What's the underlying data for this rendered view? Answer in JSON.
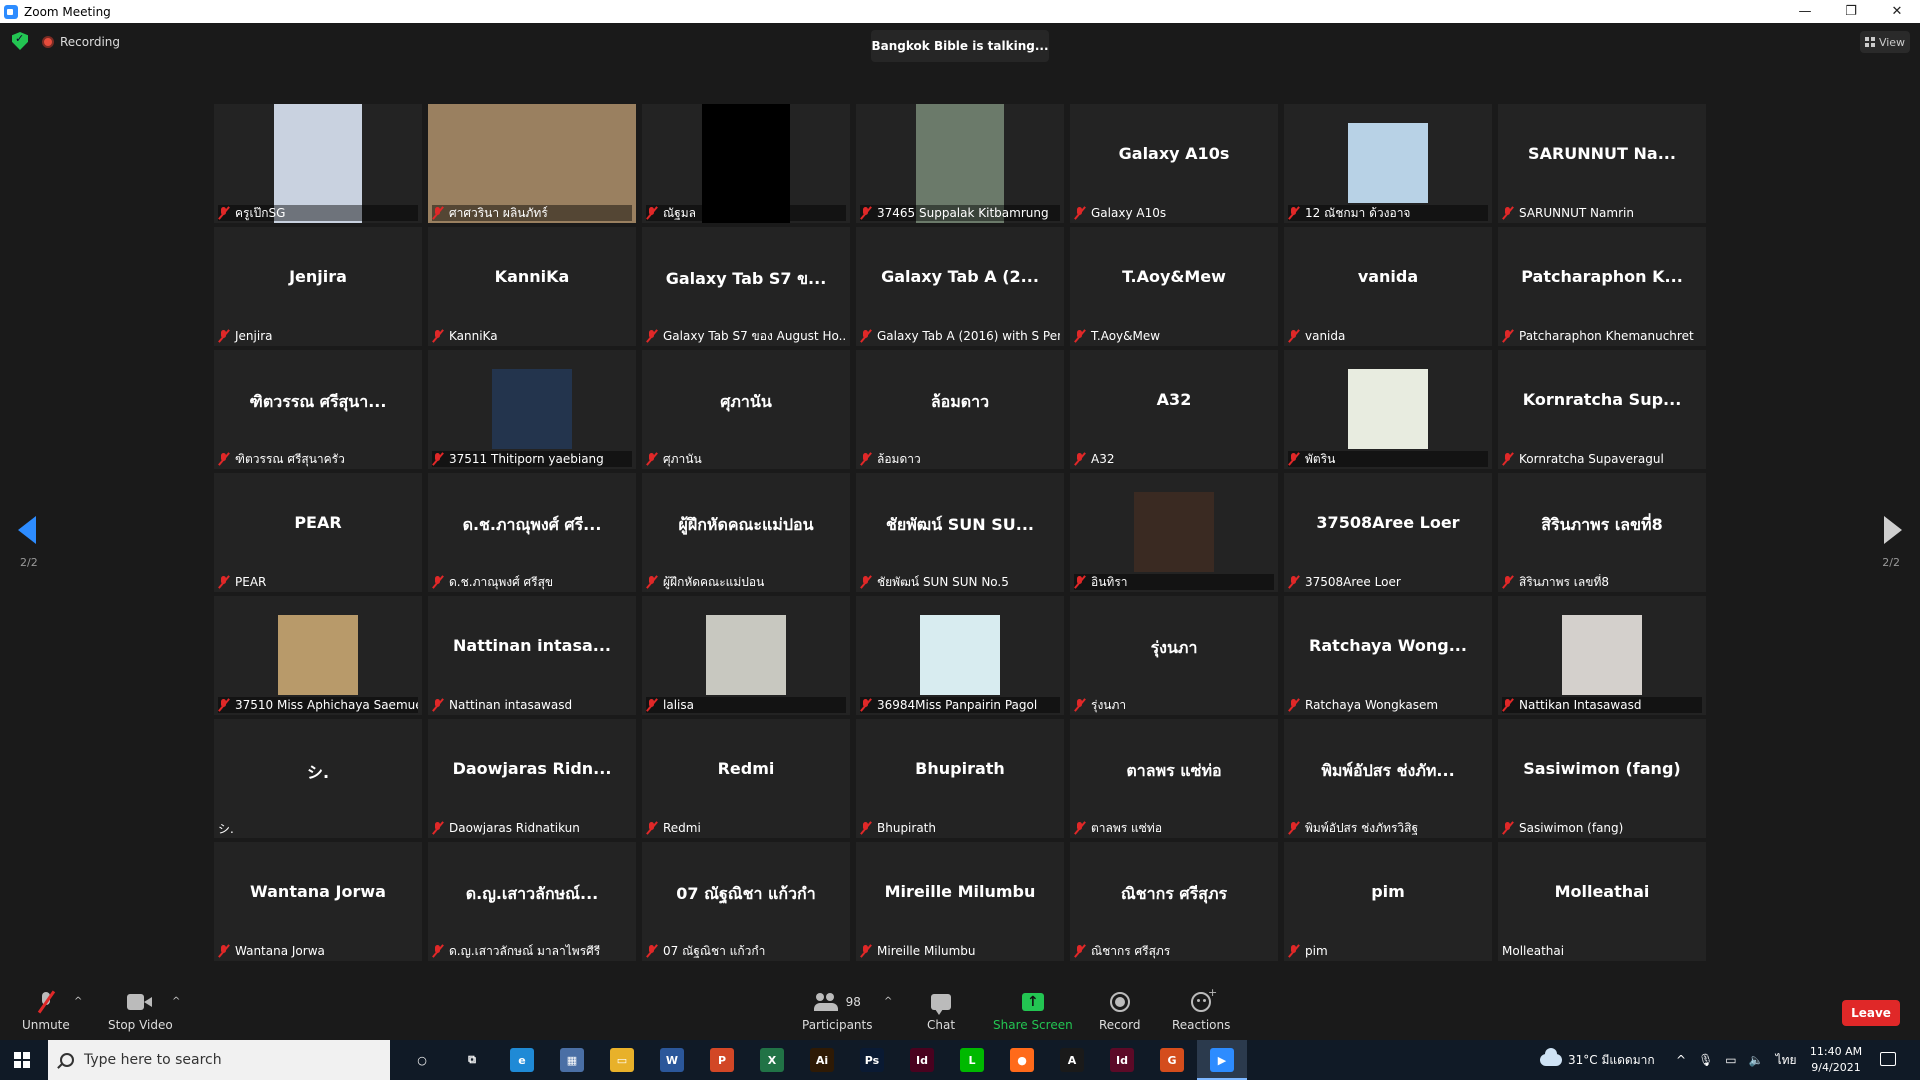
{
  "window": {
    "title": "Zoom Meeting",
    "minimize": "—",
    "restore": "❐",
    "close": "✕"
  },
  "topbar": {
    "recording": "Recording",
    "talking": "Bangkok Bible is talking...",
    "view": "View"
  },
  "page_indicator": {
    "left": "2/2",
    "right": "2/2"
  },
  "participants": [
    {
      "label": "ครูเป๊กSG",
      "photo": true,
      "photo_color": "#c9d2e0",
      "photo_type": "portrait"
    },
    {
      "label": "ศาศวรินา ผลินภัทร์",
      "photo": true,
      "photo_color": "#9a8060",
      "photo_type": "wide"
    },
    {
      "label": "ณัฐมล",
      "photo": true,
      "photo_color": "#000000",
      "photo_type": "portrait"
    },
    {
      "label": "37465 Suppalak Kitbamrung",
      "photo": true,
      "photo_color": "#6b7a6a",
      "photo_type": "portrait"
    },
    {
      "name": "Galaxy A10s",
      "label": "Galaxy A10s"
    },
    {
      "label": "12 ณัชกมา ด้วงอาจ",
      "photo": true,
      "photo_color": "#b8d2e6",
      "photo_type": "square"
    },
    {
      "name": "SARUNNUT Na...",
      "label": "SARUNNUT Namrin"
    },
    {
      "name": "Jenjira",
      "label": "Jenjira"
    },
    {
      "name": "KanniKa",
      "label": "KanniKa"
    },
    {
      "name": "Galaxy Tab S7 ข...",
      "label": "Galaxy Tab S7 ของ August Ho..."
    },
    {
      "name": "Galaxy Tab A (2...",
      "label": "Galaxy Tab A (2016) with S Pen"
    },
    {
      "name": "T.Aoy&Mew",
      "label": "T.Aoy&Mew"
    },
    {
      "name": "vanida",
      "label": "vanida"
    },
    {
      "name": "Patcharaphon K...",
      "label": "Patcharaphon Khemanuchret"
    },
    {
      "name": "ฑิตวรรณ ศรีสุนา...",
      "label": "ฑิตวรรณ ศรีสุนาครัว"
    },
    {
      "label": "37511 Thitiporn yaebiang",
      "photo": true,
      "photo_color": "#23344d",
      "photo_type": "square"
    },
    {
      "name": "ศุภานัน",
      "label": "ศุภานัน"
    },
    {
      "name": "ล้อมดาว",
      "label": "ล้อมดาว"
    },
    {
      "name": "A32",
      "label": "A32"
    },
    {
      "label": "พัตริน",
      "photo": true,
      "photo_color": "#e8ece0",
      "photo_type": "square"
    },
    {
      "name": "Kornratcha Sup...",
      "label": "Kornratcha Supaveragul"
    },
    {
      "name": "PEAR",
      "label": "PEAR"
    },
    {
      "name": "ด.ช.ภาณุพงศ์ ศรี...",
      "label": "ด.ช.ภาณุพงศ์ ศรีสุข"
    },
    {
      "name": "ผู้ฝึกหัดคณะแม่ปอน",
      "label": "ผู้ฝึกหัดคณะแม่ปอน"
    },
    {
      "name": "ชัยพัฒน์ SUN SU...",
      "label": "ชัยพัฒน์ SUN SUN No.5"
    },
    {
      "label": "อินทิรา",
      "photo": true,
      "photo_color": "#3a2a22",
      "photo_type": "square"
    },
    {
      "name": "37508Aree Loer",
      "label": "37508Aree Loer"
    },
    {
      "name": "สิรินภาพร เลขที่8",
      "label": "สิรินภาพร เลขที่8"
    },
    {
      "label": "37510 Miss Aphichaya Saemue",
      "photo": true,
      "photo_color": "#b89a6a",
      "photo_type": "square"
    },
    {
      "name": "Nattinan intasa...",
      "label": "Nattinan intasawasd"
    },
    {
      "label": "lalisa",
      "photo": true,
      "photo_color": "#c8c8c0",
      "photo_type": "square"
    },
    {
      "label": "36984Miss Panpairin Pagol",
      "photo": true,
      "photo_color": "#d8ecf0",
      "photo_type": "square"
    },
    {
      "name": "รุ่งนภา",
      "label": "รุ่งนภา"
    },
    {
      "name": "Ratchaya Wong...",
      "label": "Ratchaya Wongkasem"
    },
    {
      "label": "Nattikan Intasawasd",
      "photo": true,
      "photo_color": "#d4d0cc",
      "photo_type": "square"
    },
    {
      "name": "シ.",
      "label": "シ.",
      "unmuted": true
    },
    {
      "name": "Daowjaras Ridn...",
      "label": "Daowjaras Ridnatikun"
    },
    {
      "name": "Redmi",
      "label": "Redmi"
    },
    {
      "name": "Bhupirath",
      "label": "Bhupirath"
    },
    {
      "name": "ตาลพร แซ่ท่อ",
      "label": "ตาลพร แซ่ท่อ"
    },
    {
      "name": "พิมพ์อัปสร ช่งภัท...",
      "label": "พิมพ์อัปสร ช่งภัทรวิสิฐ"
    },
    {
      "name": "Sasiwimon (fang)",
      "label": "Sasiwimon (fang)"
    },
    {
      "name": "Wantana Jorwa",
      "label": "Wantana Jorwa"
    },
    {
      "name": "ด.ญ.เสาวลักษณ์...",
      "label": "ด.ญ.เสาวลักษณ์ มาลาไพรศีรี"
    },
    {
      "name": "07 ณัฐณิชา แก้วกำ",
      "label": "07 ณัฐณิชา แก้วกำ"
    },
    {
      "name": "Mireille Milumbu",
      "label": "Mireille Milumbu"
    },
    {
      "name": "ณิชากร ศรีสุภร",
      "label": "ณิชากร ศรีสุภร"
    },
    {
      "name": "pim",
      "label": "pim"
    },
    {
      "name": "Molleathai",
      "label": "Molleathai",
      "unmuted": true
    }
  ],
  "toolbar": {
    "unmute": "Unmute",
    "stop_video": "Stop Video",
    "participants": "Participants",
    "participants_count": "98",
    "chat": "Chat",
    "share_screen": "Share Screen",
    "record": "Record",
    "reactions": "Reactions",
    "leave": "Leave"
  },
  "taskbar": {
    "search_placeholder": "Type here to search",
    "weather": "31°C มีแดดมาก",
    "lang": "ไทย",
    "time": "11:40 AM",
    "date": "9/4/2021",
    "apps": [
      {
        "name": "cortana",
        "glyph": "○",
        "color": "transparent"
      },
      {
        "name": "task-view",
        "glyph": "⧉",
        "color": "transparent"
      },
      {
        "name": "edge",
        "glyph": "e",
        "color": "#1f8ad6"
      },
      {
        "name": "calculator",
        "glyph": "▦",
        "color": "#4a6fa5"
      },
      {
        "name": "file-explorer",
        "glyph": "▭",
        "color": "#e8b12a"
      },
      {
        "name": "word",
        "glyph": "W",
        "color": "#2b579a"
      },
      {
        "name": "powerpoint",
        "glyph": "P",
        "color": "#d24726"
      },
      {
        "name": "excel",
        "glyph": "X",
        "color": "#217346"
      },
      {
        "name": "illustrator",
        "glyph": "Ai",
        "color": "#2e1a05"
      },
      {
        "name": "photoshop",
        "glyph": "Ps",
        "color": "#0a1a33"
      },
      {
        "name": "indesign",
        "glyph": "Id",
        "color": "#49021f"
      },
      {
        "name": "line",
        "glyph": "L",
        "color": "#00b900"
      },
      {
        "name": "firefox",
        "glyph": "●",
        "color": "#ff6a1a"
      },
      {
        "name": "acrobat",
        "glyph": "A",
        "color": "#1a1a1a"
      },
      {
        "name": "indesign-2",
        "glyph": "Id",
        "color": "#5c0a27"
      },
      {
        "name": "grammarly",
        "glyph": "G",
        "color": "#d44d1c"
      },
      {
        "name": "zoom",
        "glyph": "▶",
        "color": "#2d8cff"
      }
    ]
  }
}
